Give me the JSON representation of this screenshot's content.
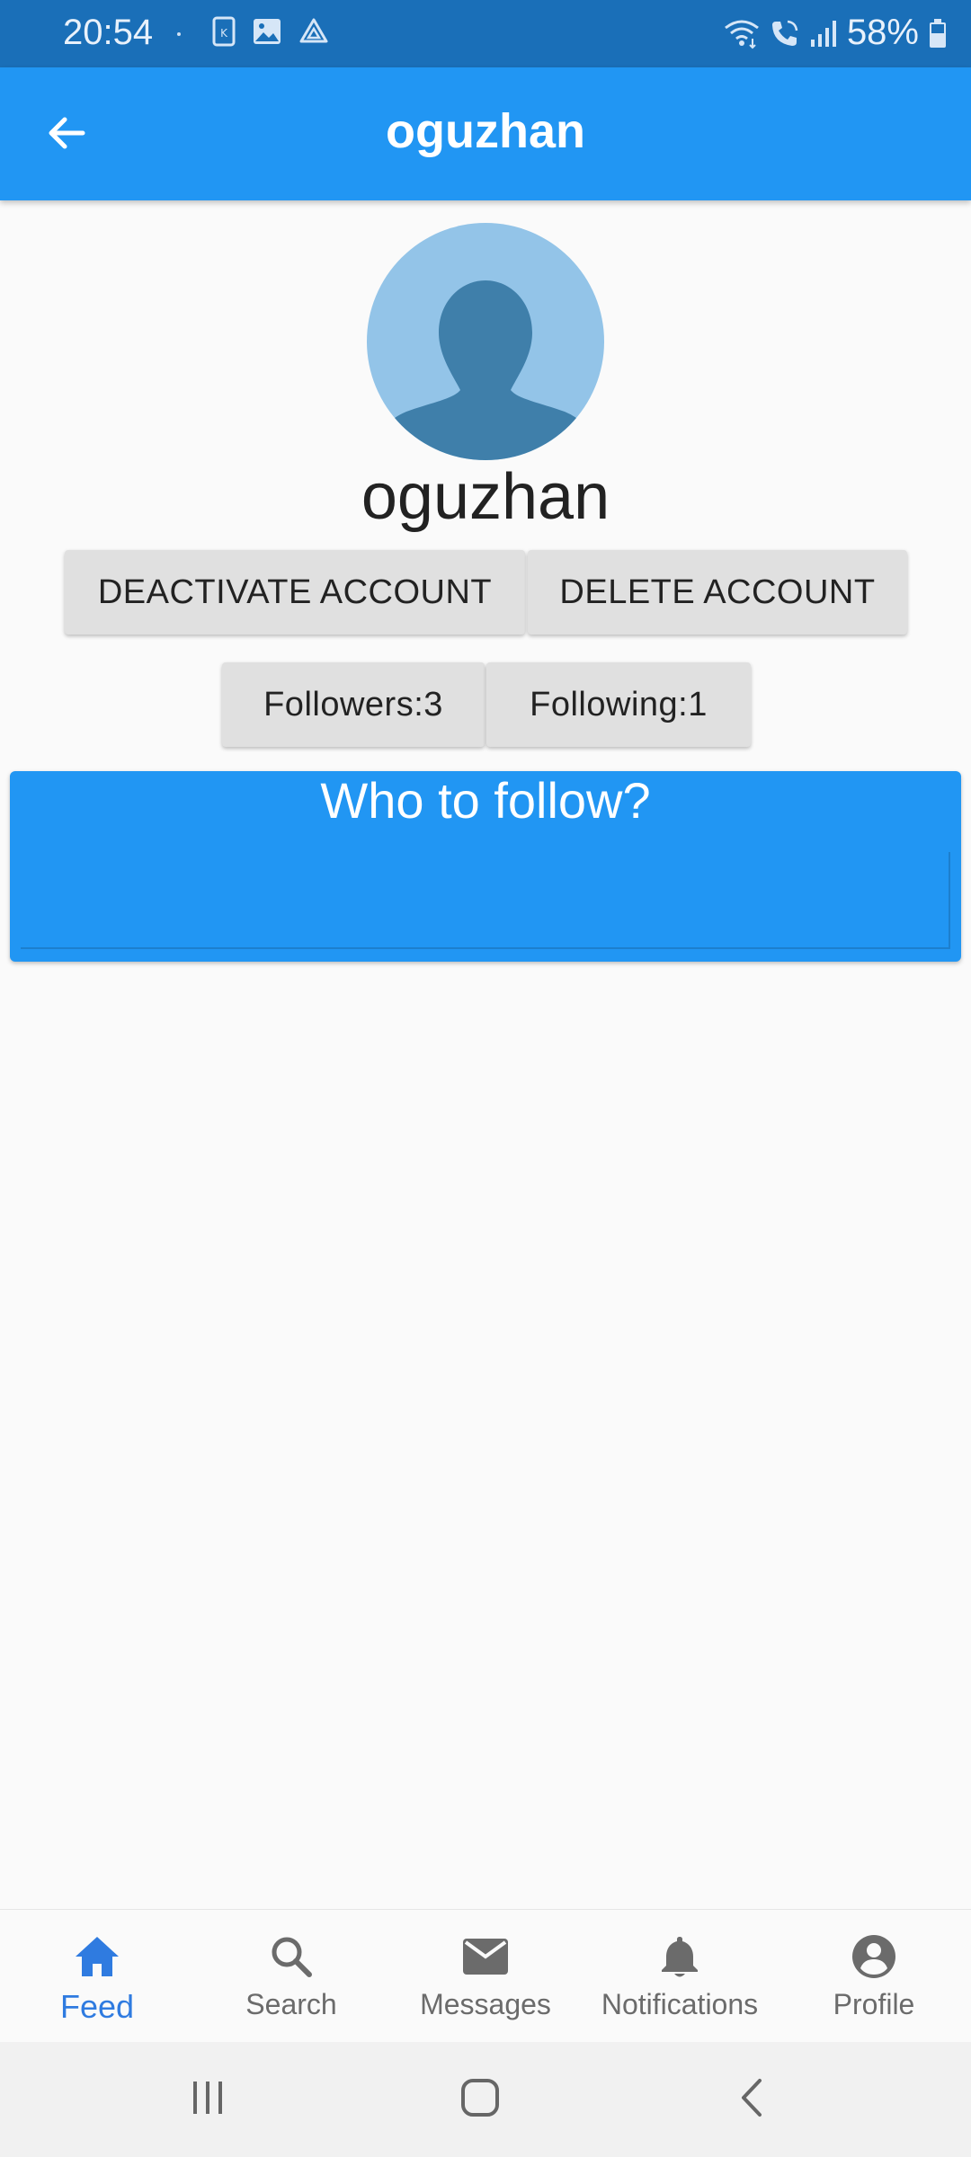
{
  "status_bar": {
    "time": "20:54",
    "battery": "58%",
    "left_icons": [
      "kakao-icon",
      "image-icon",
      "drive-icon"
    ],
    "right_icons": [
      "wifi-icon",
      "call-icon",
      "signal-icon",
      "battery-icon"
    ]
  },
  "app_bar": {
    "title": "oguzhan",
    "back_icon": "arrow-left-icon"
  },
  "profile": {
    "name": "oguzhan",
    "avatar_icon": "default-avatar-icon"
  },
  "actions": {
    "deactivate_label": "DEACTIVATE ACCOUNT",
    "delete_label": "DELETE ACCOUNT"
  },
  "stats": {
    "followers_label": "Followers:3",
    "following_label": "Following:1"
  },
  "who_to_follow": {
    "title": "Who to follow?"
  },
  "bottom_nav": {
    "items": [
      {
        "label": "Feed",
        "icon": "home-icon",
        "active": true
      },
      {
        "label": "Search",
        "icon": "search-icon",
        "active": false
      },
      {
        "label": "Messages",
        "icon": "mail-icon",
        "active": false
      },
      {
        "label": "Notifications",
        "icon": "bell-icon",
        "active": false
      },
      {
        "label": "Profile",
        "icon": "account-circle-icon",
        "active": false
      }
    ]
  },
  "colors": {
    "primary": "#2196f3",
    "status_bar": "#1a6fb8",
    "active_nav": "#2f7be0",
    "button_bg": "#e0e0e0"
  }
}
